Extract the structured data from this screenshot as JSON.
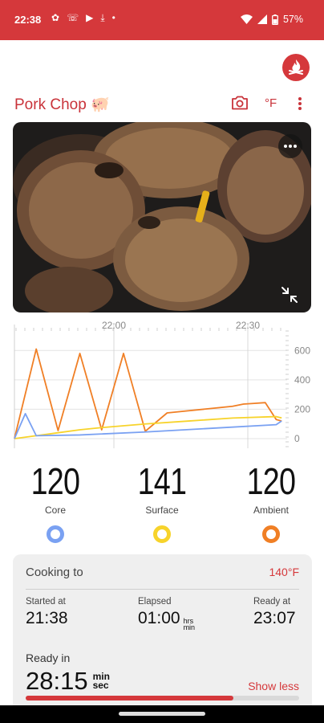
{
  "status_bar": {
    "time": "22:38",
    "battery_percent": "57%",
    "left_icons": [
      "pinwheel-icon",
      "notification-icon",
      "media-icon",
      "download-icon",
      "dot-icon"
    ],
    "right_icons": [
      "wifi-icon",
      "signal-icon",
      "battery-icon"
    ]
  },
  "header": {
    "title": "Pork Chop 🐖",
    "unit": "°F"
  },
  "photo": {
    "description_icon": "photo-of-pork-chops"
  },
  "chart_data": {
    "type": "line",
    "x_tick_labels": [
      "22:00",
      "22:30"
    ],
    "y_tick_labels": [
      "600",
      "400",
      "200",
      "0"
    ],
    "ylim": [
      0,
      700
    ],
    "series": [
      {
        "color": "#f07f25",
        "x": [
          0,
          2,
          4,
          6,
          8,
          10,
          12,
          14,
          16,
          18,
          20,
          21,
          22,
          23,
          24,
          24.5
        ],
        "values": [
          0,
          610,
          55,
          580,
          60,
          580,
          50,
          175,
          190,
          205,
          220,
          235,
          240,
          245,
          130,
          120
        ]
      },
      {
        "color": "#f7d32b",
        "x": [
          0,
          2,
          4,
          6,
          8,
          12,
          16,
          20,
          24,
          24.5
        ],
        "values": [
          0,
          20,
          40,
          60,
          75,
          100,
          120,
          140,
          150,
          141
        ]
      },
      {
        "color": "#7aa1f2",
        "x": [
          0,
          1,
          2,
          6,
          12,
          18,
          24,
          24.5
        ],
        "values": [
          0,
          170,
          20,
          25,
          45,
          70,
          95,
          120
        ]
      }
    ]
  },
  "temperatures": [
    {
      "value": "120",
      "label": "Core",
      "color": "#7aa1f2"
    },
    {
      "value": "141",
      "label": "Surface",
      "color": "#f7d32b"
    },
    {
      "value": "120",
      "label": "Ambient",
      "color": "#f07f25"
    }
  ],
  "cooking": {
    "label": "Cooking to",
    "target": "140°F",
    "started_label": "Started at",
    "started_value": "21:38",
    "elapsed_label": "Elapsed",
    "elapsed_value": "01:00",
    "elapsed_unit_top": "hrs",
    "elapsed_unit_bottom": "min",
    "ready_at_label": "Ready at",
    "ready_at_value": "23:07",
    "ready_in_label": "Ready in",
    "ready_in_value": "28:15",
    "ready_in_unit_top": "min",
    "ready_in_unit_bottom": "sec",
    "show_less": "Show less",
    "progress_fraction": 0.76
  },
  "colors": {
    "brand": "#d5383b"
  }
}
